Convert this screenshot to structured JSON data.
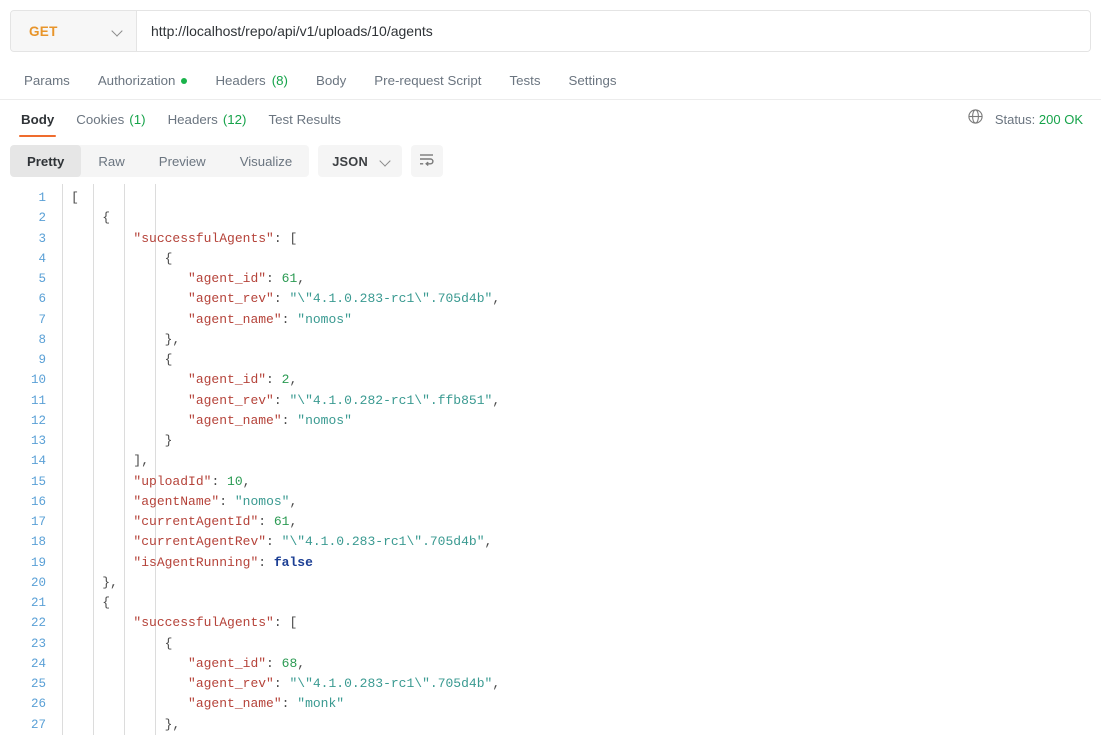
{
  "request": {
    "method": "GET",
    "method_caret_icon": "chevron-down-icon",
    "url": "http://localhost/repo/api/v1/uploads/10/agents",
    "url_placeholder": "Enter request URL",
    "tabs": [
      {
        "label": "Params",
        "badge": "",
        "dot": false
      },
      {
        "label": "Authorization",
        "badge": "",
        "dot": true
      },
      {
        "label": "Headers",
        "badge": "(8)",
        "dot": false
      },
      {
        "label": "Body",
        "badge": "",
        "dot": false
      },
      {
        "label": "Pre-request Script",
        "badge": "",
        "dot": false
      },
      {
        "label": "Tests",
        "badge": "",
        "dot": false
      },
      {
        "label": "Settings",
        "badge": "",
        "dot": false
      }
    ]
  },
  "response": {
    "tabs": [
      {
        "label": "Body",
        "badge": "",
        "active": true
      },
      {
        "label": "Cookies",
        "badge": "(1)",
        "active": false
      },
      {
        "label": "Headers",
        "badge": "(12)",
        "active": false
      },
      {
        "label": "Test Results",
        "badge": "",
        "active": false
      }
    ],
    "globe_icon": "globe-icon",
    "status_label": "Status:",
    "status_value": "200 OK",
    "viewer": {
      "modes": [
        "Pretty",
        "Raw",
        "Preview",
        "Visualize"
      ],
      "active_mode": "Pretty",
      "language": "JSON",
      "language_caret_icon": "chevron-down-icon",
      "wrap_icon": "word-wrap-icon"
    }
  },
  "colors": {
    "accent": "#ef6c2e",
    "method": "#e8952b",
    "success": "#16a34a",
    "key": "#b5433a",
    "string": "#3a9a91",
    "number": "#2a9a52",
    "boolean": "#1c3f94",
    "line_number": "#5aa0d6"
  },
  "code": {
    "lines": [
      {
        "n": 1,
        "indent": 0,
        "tokens": [
          {
            "t": "[",
            "c": "p"
          }
        ]
      },
      {
        "n": 2,
        "indent": 1,
        "tokens": [
          {
            "t": "{",
            "c": "p"
          }
        ]
      },
      {
        "n": 3,
        "indent": 2,
        "tokens": [
          {
            "t": "\"successfulAgents\"",
            "c": "k"
          },
          {
            "t": ": ",
            "c": "p"
          },
          {
            "t": "[",
            "c": "p"
          }
        ]
      },
      {
        "n": 4,
        "indent": 3,
        "tokens": [
          {
            "t": "{",
            "c": "p"
          }
        ]
      },
      {
        "n": 5,
        "indent": 4,
        "tokens": [
          {
            "t": "\"agent_id\"",
            "c": "k"
          },
          {
            "t": ": ",
            "c": "p"
          },
          {
            "t": "61",
            "c": "n"
          },
          {
            "t": ",",
            "c": "p"
          }
        ]
      },
      {
        "n": 6,
        "indent": 4,
        "tokens": [
          {
            "t": "\"agent_rev\"",
            "c": "k"
          },
          {
            "t": ": ",
            "c": "p"
          },
          {
            "t": "\"\\\"4.1.0.283-rc1\\\".705d4b\"",
            "c": "s"
          },
          {
            "t": ",",
            "c": "p"
          }
        ]
      },
      {
        "n": 7,
        "indent": 4,
        "tokens": [
          {
            "t": "\"agent_name\"",
            "c": "k"
          },
          {
            "t": ": ",
            "c": "p"
          },
          {
            "t": "\"nomos\"",
            "c": "s"
          }
        ]
      },
      {
        "n": 8,
        "indent": 3,
        "tokens": [
          {
            "t": "},",
            "c": "p"
          }
        ]
      },
      {
        "n": 9,
        "indent": 3,
        "tokens": [
          {
            "t": "{",
            "c": "p"
          }
        ]
      },
      {
        "n": 10,
        "indent": 4,
        "tokens": [
          {
            "t": "\"agent_id\"",
            "c": "k"
          },
          {
            "t": ": ",
            "c": "p"
          },
          {
            "t": "2",
            "c": "n"
          },
          {
            "t": ",",
            "c": "p"
          }
        ]
      },
      {
        "n": 11,
        "indent": 4,
        "tokens": [
          {
            "t": "\"agent_rev\"",
            "c": "k"
          },
          {
            "t": ": ",
            "c": "p"
          },
          {
            "t": "\"\\\"4.1.0.282-rc1\\\".ffb851\"",
            "c": "s"
          },
          {
            "t": ",",
            "c": "p"
          }
        ]
      },
      {
        "n": 12,
        "indent": 4,
        "tokens": [
          {
            "t": "\"agent_name\"",
            "c": "k"
          },
          {
            "t": ": ",
            "c": "p"
          },
          {
            "t": "\"nomos\"",
            "c": "s"
          }
        ]
      },
      {
        "n": 13,
        "indent": 3,
        "tokens": [
          {
            "t": "}",
            "c": "p"
          }
        ]
      },
      {
        "n": 14,
        "indent": 2,
        "tokens": [
          {
            "t": "],",
            "c": "p"
          }
        ]
      },
      {
        "n": 15,
        "indent": 2,
        "tokens": [
          {
            "t": "\"uploadId\"",
            "c": "k"
          },
          {
            "t": ": ",
            "c": "p"
          },
          {
            "t": "10",
            "c": "n"
          },
          {
            "t": ",",
            "c": "p"
          }
        ]
      },
      {
        "n": 16,
        "indent": 2,
        "tokens": [
          {
            "t": "\"agentName\"",
            "c": "k"
          },
          {
            "t": ": ",
            "c": "p"
          },
          {
            "t": "\"nomos\"",
            "c": "s"
          },
          {
            "t": ",",
            "c": "p"
          }
        ]
      },
      {
        "n": 17,
        "indent": 2,
        "tokens": [
          {
            "t": "\"currentAgentId\"",
            "c": "k"
          },
          {
            "t": ": ",
            "c": "p"
          },
          {
            "t": "61",
            "c": "n"
          },
          {
            "t": ",",
            "c": "p"
          }
        ]
      },
      {
        "n": 18,
        "indent": 2,
        "tokens": [
          {
            "t": "\"currentAgentRev\"",
            "c": "k"
          },
          {
            "t": ": ",
            "c": "p"
          },
          {
            "t": "\"\\\"4.1.0.283-rc1\\\".705d4b\"",
            "c": "s"
          },
          {
            "t": ",",
            "c": "p"
          }
        ]
      },
      {
        "n": 19,
        "indent": 2,
        "tokens": [
          {
            "t": "\"isAgentRunning\"",
            "c": "k"
          },
          {
            "t": ": ",
            "c": "p"
          },
          {
            "t": "false",
            "c": "b"
          }
        ]
      },
      {
        "n": 20,
        "indent": 1,
        "tokens": [
          {
            "t": "},",
            "c": "p"
          }
        ]
      },
      {
        "n": 21,
        "indent": 1,
        "tokens": [
          {
            "t": "{",
            "c": "p"
          }
        ]
      },
      {
        "n": 22,
        "indent": 2,
        "tokens": [
          {
            "t": "\"successfulAgents\"",
            "c": "k"
          },
          {
            "t": ": ",
            "c": "p"
          },
          {
            "t": "[",
            "c": "p"
          }
        ]
      },
      {
        "n": 23,
        "indent": 3,
        "tokens": [
          {
            "t": "{",
            "c": "p"
          }
        ]
      },
      {
        "n": 24,
        "indent": 4,
        "tokens": [
          {
            "t": "\"agent_id\"",
            "c": "k"
          },
          {
            "t": ": ",
            "c": "p"
          },
          {
            "t": "68",
            "c": "n"
          },
          {
            "t": ",",
            "c": "p"
          }
        ]
      },
      {
        "n": 25,
        "indent": 4,
        "tokens": [
          {
            "t": "\"agent_rev\"",
            "c": "k"
          },
          {
            "t": ": ",
            "c": "p"
          },
          {
            "t": "\"\\\"4.1.0.283-rc1\\\".705d4b\"",
            "c": "s"
          },
          {
            "t": ",",
            "c": "p"
          }
        ]
      },
      {
        "n": 26,
        "indent": 4,
        "tokens": [
          {
            "t": "\"agent_name\"",
            "c": "k"
          },
          {
            "t": ": ",
            "c": "p"
          },
          {
            "t": "\"monk\"",
            "c": "s"
          }
        ]
      },
      {
        "n": 27,
        "indent": 3,
        "tokens": [
          {
            "t": "},",
            "c": "p"
          }
        ]
      }
    ]
  }
}
